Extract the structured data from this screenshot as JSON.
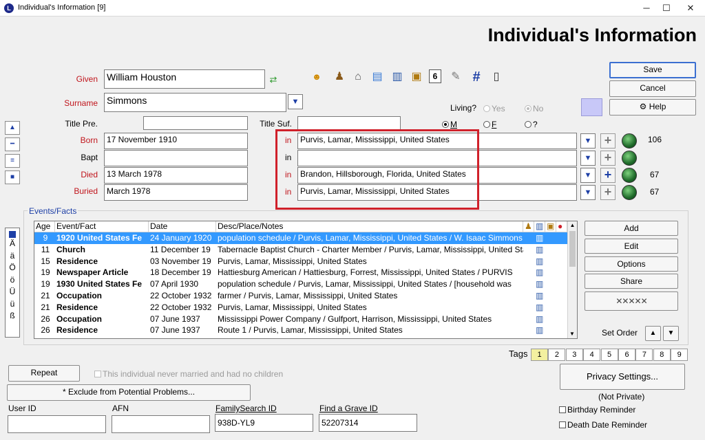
{
  "window": {
    "title": "Individual's Information  [9]",
    "minimize": "─",
    "maximize": "☐",
    "close": "✕"
  },
  "header": {
    "title": "Individual's Information"
  },
  "labels": {
    "given": "Given",
    "surname": "Surname",
    "title_pre": "Title Pre.",
    "title_suf": "Title Suf.",
    "born": "Born",
    "bapt": "Bapt",
    "died": "Died",
    "buried": "Buried",
    "in": "in",
    "living": "Living?",
    "yes": "Yes",
    "no": "No",
    "m": "M",
    "f": "F",
    "unknown": "?"
  },
  "fields": {
    "given": "William Houston",
    "surname": "Simmons",
    "title_pre": "",
    "title_suf": "",
    "born_date": "17 November 1910",
    "born_place": "Purvis, Lamar, Mississippi, United States",
    "born_count": "106",
    "bapt_date": "",
    "bapt_place": "",
    "died_date": "13 March 1978",
    "died_place": "Brandon, Hillsborough, Florida, United States",
    "died_count": "67",
    "buried_date": "March 1978",
    "buried_place": "Purvis, Lamar, Mississippi, United States",
    "buried_count": "67"
  },
  "buttons": {
    "save": "Save",
    "cancel": "Cancel",
    "help": "Help",
    "add": "Add",
    "edit": "Edit",
    "options": "Options",
    "share": "Share",
    "set_order": "Set Order",
    "repeat": "Repeat",
    "exclude": "* Exclude from Potential Problems...",
    "privacy": "Privacy Settings..."
  },
  "events": {
    "group_label": "Events/Facts",
    "columns": [
      "Age",
      "Event/Fact",
      "Date",
      "Desc/Place/Notes"
    ],
    "rows": [
      {
        "age": "9",
        "event": "1920 United States Fe",
        "date": "24 January 1920",
        "desc": "population schedule / Purvis, Lamar, Mississippi, United States / W. Isaac Simmons"
      },
      {
        "age": "11",
        "event": "Church",
        "date": "11 December 19",
        "desc": "Tabernacle Baptist Church - Charter Member / Purvis, Lamar, Mississippi, United States"
      },
      {
        "age": "15",
        "event": "Residence",
        "date": "03 November 19",
        "desc": "Purvis, Lamar, Mississippi, United States"
      },
      {
        "age": "19",
        "event": "Newspaper Article",
        "date": "18 December 19",
        "desc": "Hattiesburg American / Hattiesburg, Forrest, Mississippi, United States / PURVIS"
      },
      {
        "age": "19",
        "event": "1930 United States Fe",
        "date": "07 April 1930",
        "desc": "population schedule / Purvis, Lamar, Mississippi, United States / [household was"
      },
      {
        "age": "21",
        "event": "Occupation",
        "date": "22 October 1932",
        "desc": "farmer / Purvis, Lamar, Mississippi, United States"
      },
      {
        "age": "21",
        "event": "Residence",
        "date": "22 October 1932",
        "desc": "Purvis, Lamar, Mississippi, United States"
      },
      {
        "age": "26",
        "event": "Occupation",
        "date": "07 June 1937",
        "desc": "Mississippi Power Company / Gulfport, Harrison, Mississippi, United States"
      },
      {
        "age": "26",
        "event": "Residence",
        "date": "07 June 1937",
        "desc": "Route 1 / Purvis, Lamar, Mississippi, United States"
      }
    ]
  },
  "special_chars": [
    "Ä",
    "ä",
    "Ö",
    "ö",
    "Ü",
    "ü",
    "ß"
  ],
  "tags": {
    "label": "Tags",
    "items": [
      "1",
      "2",
      "3",
      "4",
      "5",
      "6",
      "7",
      "8",
      "9"
    ]
  },
  "never_married": "This individual never married and had no children",
  "ids": {
    "user_id_label": "User ID",
    "user_id": "",
    "afn_label": "AFN",
    "afn": "",
    "familysearch_label": "FamilySearch ID",
    "familysearch": "938D-YL9",
    "findagrave_label": "Find a Grave ID",
    "findagrave": "52207314"
  },
  "privacy_status": "(Not Private)",
  "reminders": {
    "birthday": "Birthday Reminder",
    "death": "Death Date Reminder"
  },
  "colors": {
    "accent": "#1d3fa6",
    "highlight": "#3399ff",
    "required_label": "#c0141b",
    "callout": "#d0202a"
  }
}
